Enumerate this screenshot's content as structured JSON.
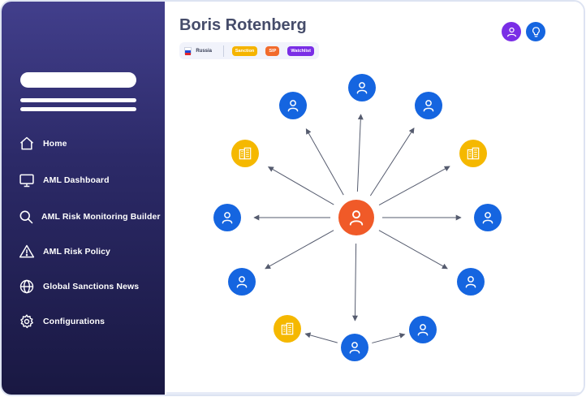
{
  "profile": {
    "name": "Boris Rotenberg",
    "country": "Russia",
    "badges": [
      {
        "label": "Sanction",
        "color": "#f5b400"
      },
      {
        "label": "SIP",
        "color": "#f26b2c"
      },
      {
        "label": "Watchlist",
        "color": "#7a2ee6"
      }
    ]
  },
  "nav": {
    "items": [
      {
        "label": "Home",
        "icon": "home-icon"
      },
      {
        "label": "AML Dashboard",
        "icon": "monitor-icon"
      },
      {
        "label": "AML Risk Monitoring Builder",
        "icon": "search-icon"
      },
      {
        "label": "AML Risk Policy",
        "icon": "warning-icon"
      },
      {
        "label": "Global Sanctions News",
        "icon": "globe-icon"
      },
      {
        "label": "Configurations",
        "icon": "gear-icon"
      }
    ]
  },
  "header_icons": [
    {
      "icon": "user-icon",
      "color": "#7a2ee6"
    },
    {
      "icon": "lightbulb-icon",
      "color": "#1565e0"
    }
  ],
  "colors": {
    "center_node": "#f05a28",
    "person_node": "#1565e0",
    "company_node": "#f5b800",
    "arrow": "#555b6e"
  },
  "network": {
    "center": {
      "type": "person"
    },
    "nodes": [
      {
        "type": "person",
        "links_from": "center"
      },
      {
        "type": "person",
        "links_from": "center"
      },
      {
        "type": "person",
        "links_from": "center"
      },
      {
        "type": "company",
        "links_from": "center"
      },
      {
        "type": "company",
        "links_from": "center"
      },
      {
        "type": "person",
        "links_from": "center"
      },
      {
        "type": "person",
        "links_from": "center"
      },
      {
        "type": "person",
        "links_from": "center"
      },
      {
        "type": "person",
        "links_from": "center"
      },
      {
        "type": "person",
        "links_from": "center"
      },
      {
        "type": "company",
        "links_from": "node-10"
      },
      {
        "type": "person",
        "links_from": "node-10"
      }
    ]
  }
}
